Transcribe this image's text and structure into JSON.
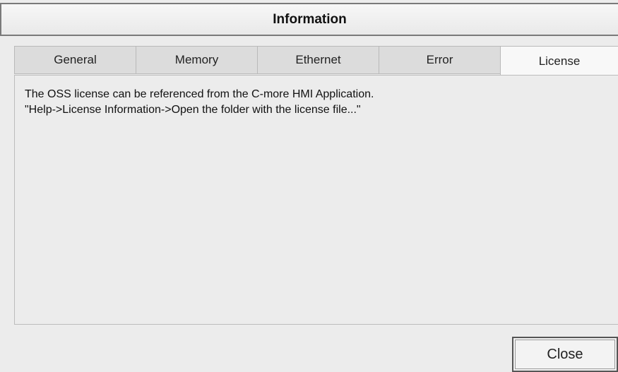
{
  "window": {
    "title": "Information"
  },
  "tabs": [
    {
      "label": "General"
    },
    {
      "label": "Memory"
    },
    {
      "label": "Ethernet"
    },
    {
      "label": "Error"
    },
    {
      "label": "License"
    }
  ],
  "active_tab": "License",
  "content": {
    "line1": "The OSS license can be referenced from the C-more HMI Application.",
    "line2": "\"Help->License Information->Open the folder with the license file...\""
  },
  "footer": {
    "close_label": "Close"
  },
  "colors": {
    "background": "#ececec",
    "active_tab": "#f8f8f8",
    "inactive_tab": "#dcdcdc"
  }
}
